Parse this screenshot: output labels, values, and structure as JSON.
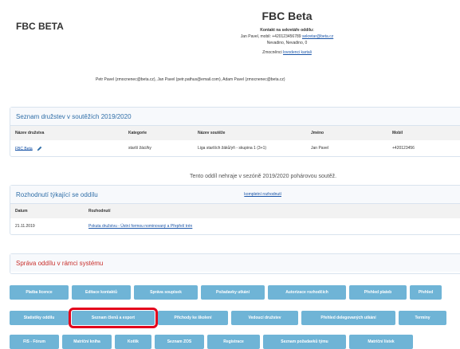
{
  "header": {
    "club_short": "FBC BETA",
    "club_title": "FBC Beta",
    "contact_heading": "Kontakt na sekretáře oddílu:",
    "contact_line_prefix": "Jan Pavel, mobil: +420123456789",
    "contact_email": "sekretar@beta.cz",
    "address": "Nevadino, Nevadino, 0",
    "proxies_prefix": "Zmocněnci",
    "proxies_link": "lovodenci kartali",
    "contacts_line": "Petr Pavel (zmocnenec@beta.cz), Jan Pavel (petr.pathus@email.com), Adam Pavel (zmocnenec@beta.cz)"
  },
  "teams": {
    "title": "Seznam družstev v soutěžích 2019/2020",
    "columns": [
      "Název družstva",
      "Kategorie",
      "Název soutěže",
      "Jméno",
      "Mobil"
    ],
    "rows": [
      {
        "team": "FBC Beta",
        "category": "starší žáci/ky",
        "competition": "Liga starších žáků/yň - skupina 1 (3+1)",
        "name": "Jan Pavel",
        "mobile": "+420123456"
      }
    ]
  },
  "note": "Tento oddíl nehraje v sezóně 2019/2020 pohárovou soutěž.",
  "decisions": {
    "title": "Rozhodnutí týkající se oddílu",
    "link": "kompletní rozhodnutí",
    "columns": [
      "Datum",
      "Rozhodnutí"
    ],
    "rows": [
      {
        "date": "21.11.2019",
        "text": "Pokuta družstvu - Ústní formou nominovaný a Přepřelí trén"
      }
    ]
  },
  "management": {
    "title": "Správa oddílu v rámci systému",
    "row1": [
      "Platba licence",
      "Editace kontaktů",
      "Správa soupisek",
      "Požadavky utkání",
      "Autorizace rozhodčích",
      "Přehled plateb",
      "Přehled"
    ],
    "row2": [
      "Statistiky oddílu",
      "Seznam členů a export",
      "Příchody ke školení",
      "Vedoucí družstev",
      "Přehled delegovaných utkání",
      "Termíny"
    ],
    "row3": [
      "FIS - Fórum",
      "Matriční kniha",
      "Kotlík",
      "Seznam ZOS",
      "Registrace",
      "Seznam požadavků týmu",
      "Matriční lístek"
    ]
  },
  "colors": {
    "button": "#6fb4d6",
    "highlight": "#e3001b",
    "panel_title": "#2f6ea8",
    "panel_title_red": "#c9302c"
  }
}
